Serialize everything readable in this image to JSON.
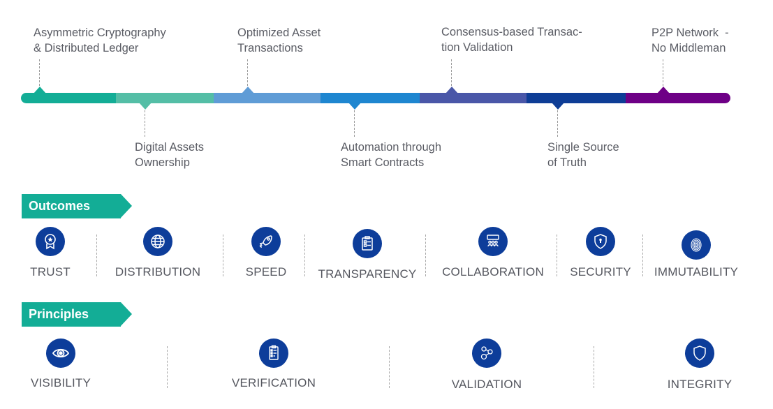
{
  "timeline": {
    "colors": [
      "#13ad96",
      "#54bea6",
      "#5f9cd6",
      "#1e86d0",
      "#4a57a8",
      "#0e3d96",
      "#6e0086"
    ],
    "milestones": [
      {
        "label_line1": "Asymmetric Cryptography",
        "label_line2": "& Distributed Ledger",
        "position": "above"
      },
      {
        "label_line1": "Digital Assets",
        "label_line2": "Ownership",
        "position": "below"
      },
      {
        "label_line1": "Optimized Asset",
        "label_line2": "Transactions",
        "position": "above"
      },
      {
        "label_line1": "Automation through",
        "label_line2": "Smart Contracts",
        "position": "below"
      },
      {
        "label_line1": "Consensus-based Transac-",
        "label_line2": "tion Validation",
        "position": "above"
      },
      {
        "label_line1": "Single Source",
        "label_line2": "of Truth",
        "position": "below"
      },
      {
        "label_line1": "P2P Network  -",
        "label_line2": "No Middleman",
        "position": "above"
      }
    ]
  },
  "outcomes": {
    "title": "Outcomes",
    "tag_color": "#13ad96",
    "items": [
      {
        "label": "TRUST",
        "icon": "award-badge-icon"
      },
      {
        "label": "DISTRIBUTION",
        "icon": "globe-icon"
      },
      {
        "label": "SPEED",
        "icon": "rocket-icon"
      },
      {
        "label": "TRANSPARENCY",
        "icon": "clipboard-checklist-icon"
      },
      {
        "label": "COLLABORATION",
        "icon": "team-presentation-icon"
      },
      {
        "label": "SECURITY",
        "icon": "shield-lock-icon"
      },
      {
        "label": "IMMUTABILITY",
        "icon": "fingerprint-icon"
      }
    ]
  },
  "principles": {
    "title": "Principles",
    "tag_color": "#13ad96",
    "items": [
      {
        "label": "VISIBILITY",
        "icon": "eye-icon"
      },
      {
        "label": "VERIFICATION",
        "icon": "checklist-clipboard-icon"
      },
      {
        "label": "VALIDATION",
        "icon": "network-users-icon"
      },
      {
        "label": "INTEGRITY",
        "icon": "shield-icon"
      }
    ]
  },
  "icon_color": "#0d3d9a"
}
